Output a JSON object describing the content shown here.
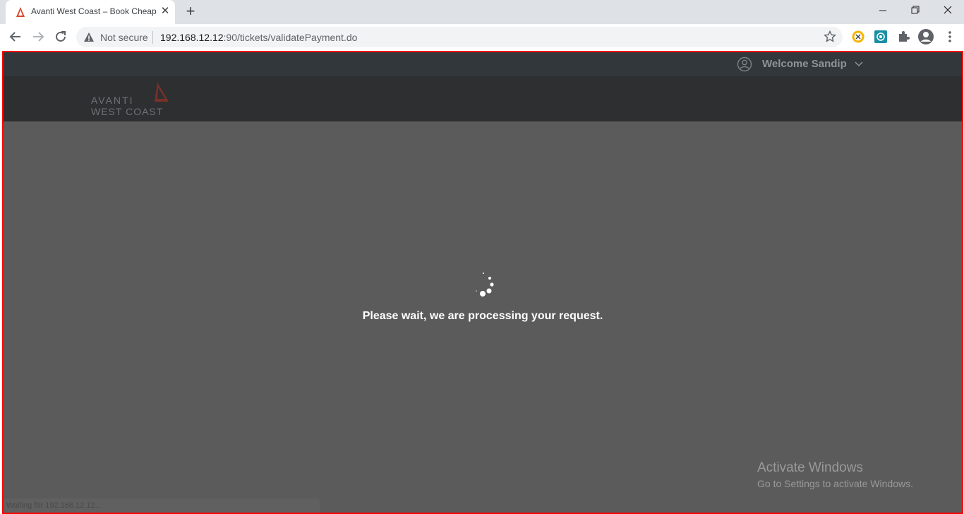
{
  "browser": {
    "tab": {
      "title": "Avanti West Coast – Book Cheap",
      "favicon": "avanti-logo-icon",
      "close_icon": "close-icon"
    },
    "new_tab": "+",
    "window_controls": [
      "minimize-icon",
      "restore-icon",
      "close-icon"
    ],
    "address_bar": {
      "security_label": "Not secure",
      "url_host": "192.168.12.12",
      "url_rest": ":90/tickets/validatePayment.do"
    },
    "toolbar_icons": [
      "back-icon",
      "forward-icon",
      "reload-icon",
      "star-icon",
      "extension-icon",
      "extension-icon",
      "puzzle-icon",
      "profile-icon",
      "menu-icon"
    ]
  },
  "page": {
    "user_menu": {
      "label": "Welcome Sandip"
    },
    "logo": {
      "line1": "AVANTI",
      "line2": "WEST COAST"
    },
    "loading_message": "Please wait, we are processing your request.",
    "status_bar": "Waiting for 192.168.12.12..."
  },
  "os_overlay": {
    "title": "Activate Windows",
    "subtitle": "Go to Settings to activate Windows."
  },
  "colors": {
    "overlay": "#5b5b5b",
    "topbar": "#32373b",
    "header": "#2d2f31",
    "brand_accent": "#c1392b",
    "frame_border": "#ff0000"
  }
}
